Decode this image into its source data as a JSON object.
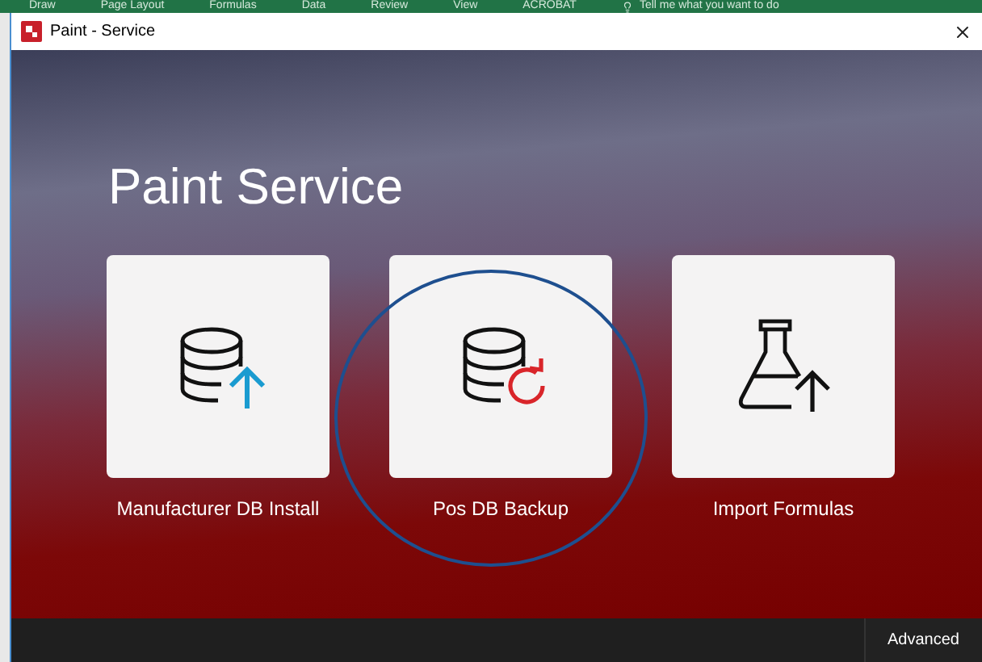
{
  "ribbon": {
    "tabs": [
      "Draw",
      "Page Layout",
      "Formulas",
      "Data",
      "Review",
      "View",
      "ACROBAT"
    ],
    "search": "Tell me what you want to do"
  },
  "window": {
    "title": "Paint - Service"
  },
  "heading": "Paint Service",
  "cards": [
    {
      "label": "Manufacturer DB Install",
      "kind": "install"
    },
    {
      "label": "Pos DB Backup",
      "kind": "backup"
    },
    {
      "label": "Import Formulas",
      "kind": "import"
    }
  ],
  "footer": {
    "button": "Advanced"
  }
}
